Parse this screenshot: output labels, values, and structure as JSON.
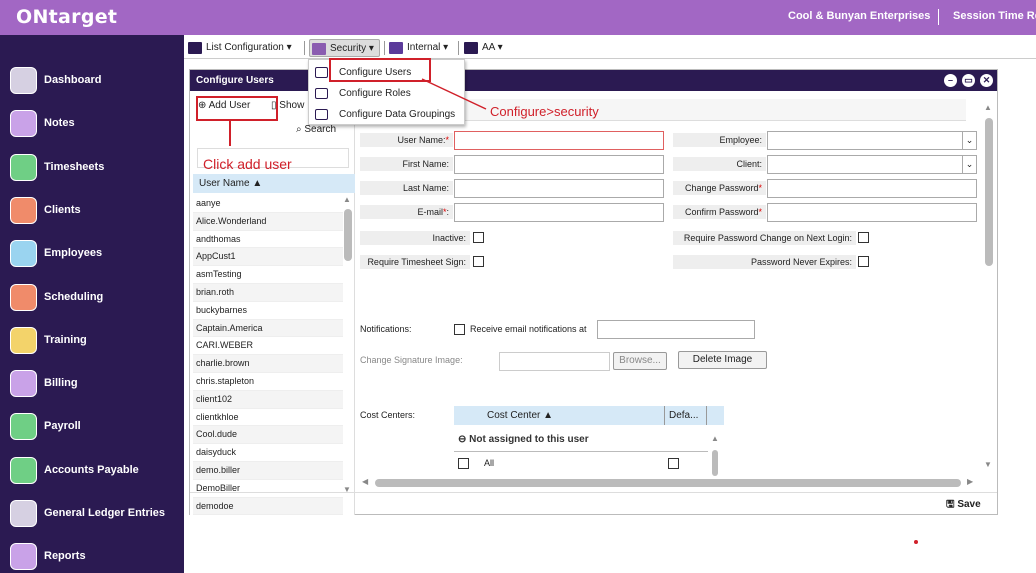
{
  "app": {
    "logo": "ONtarget",
    "company": "Cool & Bunyan Enterprises",
    "session": "Session Time Re"
  },
  "sidebar": {
    "items": [
      {
        "label": "Dashboard",
        "icon": "dashboard-icon"
      },
      {
        "label": "Notes",
        "icon": "notes-icon"
      },
      {
        "label": "Timesheets",
        "icon": "clock-icon"
      },
      {
        "label": "Clients",
        "icon": "folder-icon"
      },
      {
        "label": "Employees",
        "icon": "folder-icon"
      },
      {
        "label": "Scheduling",
        "icon": "calendar-icon"
      },
      {
        "label": "Training",
        "icon": "folder-icon"
      },
      {
        "label": "Billing",
        "icon": "folder-icon"
      },
      {
        "label": "Payroll",
        "icon": "folder-icon"
      },
      {
        "label": "Accounts Payable",
        "icon": "folder-icon"
      },
      {
        "label": "General Ledger Entries",
        "icon": "ledger-icon"
      },
      {
        "label": "Reports",
        "icon": "reports-icon"
      }
    ]
  },
  "toolbar": {
    "list_config": "List Configuration",
    "security": "Security",
    "internal": "Internal",
    "aa": "AA"
  },
  "security_menu": {
    "items": [
      "Configure Users",
      "Configure Roles",
      "Configure Data Groupings"
    ]
  },
  "panel": {
    "title": "Configure Users",
    "add_user": "Add User",
    "show": "Show",
    "search": "Search",
    "save": "Save"
  },
  "user_list": {
    "header": "User Name",
    "users": [
      "aanye",
      "Alice.Wonderland",
      "andthomas",
      "AppCust1",
      "asmTesting",
      "brian.roth",
      "buckybarnes",
      "Captain.America",
      "CARI.WEBER",
      "charlie.brown",
      "chris.stapleton",
      "client102",
      "clientkhloe",
      "Cool.dude",
      "daisyduck",
      "demo.biller",
      "DemoBiller",
      "demodoe"
    ]
  },
  "form": {
    "user_name": "User Name",
    "first_name": "First Name:",
    "last_name": "Last Name:",
    "email": "E-mail",
    "inactive": "Inactive:",
    "require_ts_sign": "Require Timesheet Sign:",
    "employee": "Employee:",
    "client": "Client:",
    "change_password": "Change Password",
    "confirm_password": "Confirm Password",
    "require_pw_change": "Require Password Change on Next Login:",
    "pw_never_expires": "Password Never Expires:",
    "notifications": "Notifications:",
    "receive_email": "Receive email notifications at",
    "change_sig": "Change Signature Image:",
    "browse": "Browse...",
    "delete_image": "Delete Image",
    "cost_centers": "Cost Centers:",
    "cost_center_col": "Cost Center",
    "default_col": "Defa...",
    "not_assigned": "Not assigned to this user",
    "all": "All"
  },
  "annotations": {
    "click_add": "Click add user",
    "configure_security": "Configure>security"
  },
  "colors": {
    "brand": "#a267c4",
    "sidebar": "#2b1a52",
    "annotation": "#d0202a"
  }
}
